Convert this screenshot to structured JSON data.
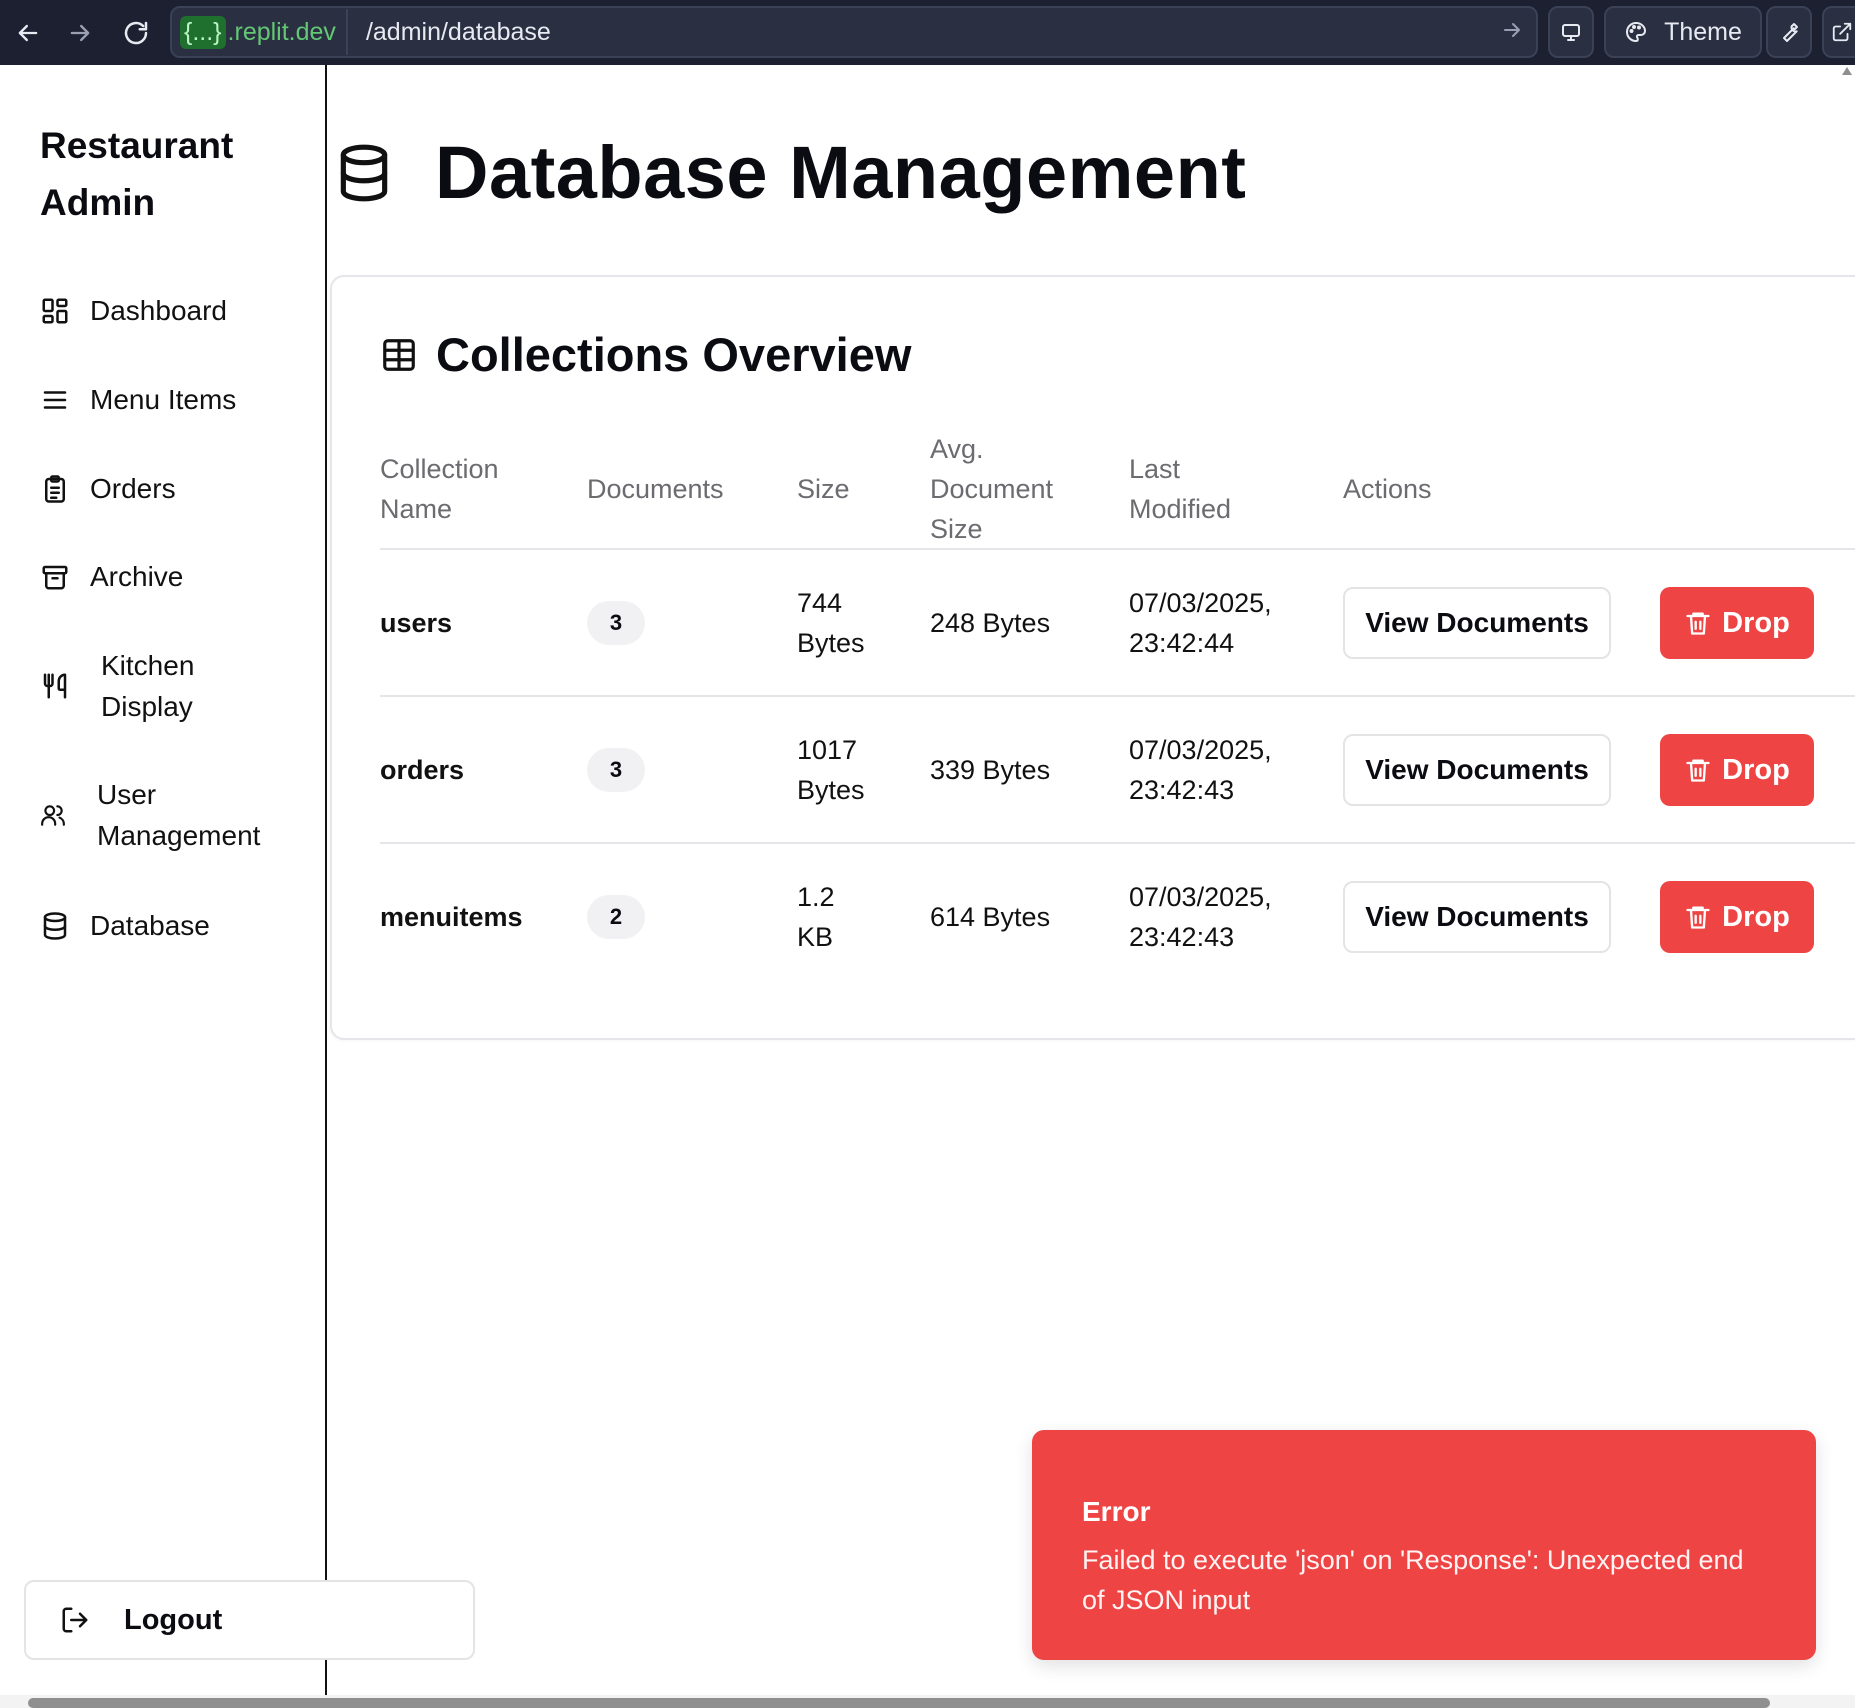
{
  "browser": {
    "domain_badge": "{...}",
    "domain_suffix": ".replit.dev",
    "path": "/admin/database",
    "theme_label": "Theme"
  },
  "sidebar": {
    "brand": "Restaurant Admin",
    "items": [
      {
        "label": "Dashboard",
        "icon": "layout-dashboard-icon"
      },
      {
        "label": "Menu Items",
        "icon": "menu-lines-icon"
      },
      {
        "label": "Orders",
        "icon": "clipboard-list-icon"
      },
      {
        "label": "Archive",
        "icon": "archive-icon"
      },
      {
        "label": "Kitchen Display",
        "icon": "utensils-icon"
      },
      {
        "label": "User Management",
        "icon": "users-icon"
      },
      {
        "label": "Database",
        "icon": "database-icon"
      }
    ],
    "logout_label": "Logout"
  },
  "page": {
    "title": "Database Management"
  },
  "collections": {
    "title": "Collections Overview",
    "headers": {
      "name": "Collection Name",
      "documents": "Documents",
      "size": "Size",
      "avg": "Avg. Document Size",
      "modified": "Last Modified",
      "actions": "Actions"
    },
    "rows": [
      {
        "name": "users",
        "documents": "3",
        "size": "744 Bytes",
        "avg": "248 Bytes",
        "modified": "07/03/2025, 23:42:44"
      },
      {
        "name": "orders",
        "documents": "3",
        "size": "1017 Bytes",
        "avg": "339 Bytes",
        "modified": "07/03/2025, 23:42:43"
      },
      {
        "name": "menuitems",
        "documents": "2",
        "size": "1.2 KB",
        "avg": "614 Bytes",
        "modified": "07/03/2025, 23:42:43"
      }
    ],
    "view_label": "View Documents",
    "drop_label": "Drop"
  },
  "toast": {
    "title": "Error",
    "message": "Failed to execute 'json' on 'Response': Unexpected end of JSON input"
  },
  "colors": {
    "danger": "#ef4444",
    "browser_bar": "#1c2030"
  }
}
